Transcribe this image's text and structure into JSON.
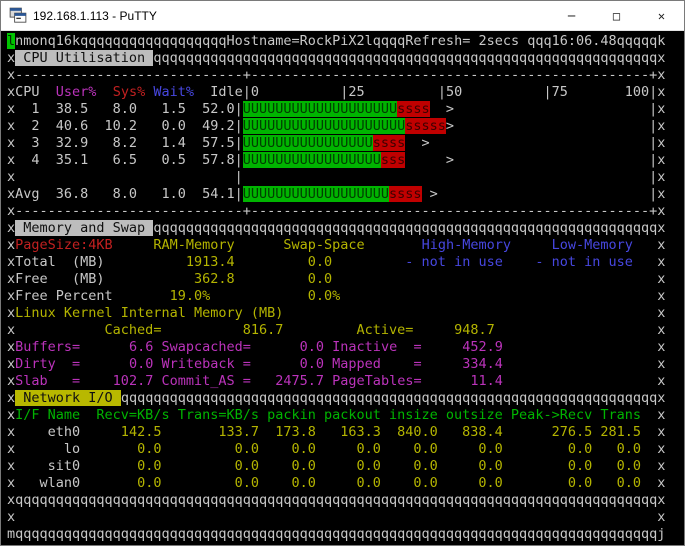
{
  "window": {
    "title": "192.168.1.113 - PuTTY",
    "minimize_icon": "─",
    "maximize_icon": "□",
    "close_icon": "✕"
  },
  "palette": {
    "terminal_bg": "#000000",
    "default_text": "#c8c8c8",
    "user_bar_green": "#00b400",
    "sys_bar_red": "#c00000",
    "value_yellow": "#b4b400",
    "kernel_magenta": "#bb33bb",
    "header_blue": "#4747e0",
    "section_inverse_grey": "#bdbdbd",
    "network_inverse_yellow": "#b8b800"
  },
  "terminal": {
    "lines": [
      {
        "right": "k",
        "seg": [
          {
            "t": "l",
            "s": "cur"
          },
          {
            "t": "nmonq16k"
          },
          {
            "t": "q",
            "r": 18
          },
          {
            "t": "Hostname=RockPiX2"
          },
          {
            "t": "lqqqq"
          },
          {
            "t": "Refresh= 2secs "
          },
          {
            "t": "qqq"
          },
          {
            "t": "16:06.48"
          },
          {
            "t": "q",
            "r": 5
          }
        ]
      },
      {
        "right": "x",
        "seg": [
          {
            "t": "x"
          },
          {
            "t": " CPU Utilisation ",
            "s": "inv"
          },
          {
            "t": "q",
            "r": 62
          }
        ]
      },
      {
        "right": "x",
        "seg": [
          {
            "t": "x"
          },
          {
            "t": "-",
            "r": 28
          },
          {
            "t": "+"
          },
          {
            "t": "-",
            "r": 49
          },
          {
            "t": "+"
          }
        ]
      },
      {
        "right": "x",
        "seg": [
          {
            "t": "x"
          },
          {
            "t": "CPU  "
          },
          {
            "t": "User%",
            "s": "mag"
          },
          {
            "t": "  "
          },
          {
            "t": "Sys%",
            "s": "red"
          },
          {
            "t": " "
          },
          {
            "t": "Wait%",
            "s": "blu"
          },
          {
            "t": "  "
          },
          {
            "t": "Idle"
          },
          {
            "t": "|0          |25         |50          |75       100|"
          }
        ]
      },
      {
        "right": "x",
        "seg": [
          {
            "t": "x"
          },
          {
            "t": "  1  38.5   8.0   1.5  52.0|"
          },
          {
            "t": "U",
            "s": "ub",
            "r": 19
          },
          {
            "t": "s",
            "s": "sb",
            "r": 4
          },
          {
            "t": "  >"
          },
          {
            "t": " ",
            "r": 24
          },
          {
            "t": "|"
          }
        ]
      },
      {
        "right": "x",
        "seg": [
          {
            "t": "x"
          },
          {
            "t": "  2  40.6  10.2   0.0  49.2|"
          },
          {
            "t": "U",
            "s": "ub",
            "r": 20
          },
          {
            "t": "s",
            "s": "sb",
            "r": 5
          },
          {
            "t": ">"
          },
          {
            "t": " ",
            "r": 24
          },
          {
            "t": "|"
          }
        ]
      },
      {
        "right": "x",
        "seg": [
          {
            "t": "x"
          },
          {
            "t": "  3  32.9   8.2   1.4  57.5|"
          },
          {
            "t": "U",
            "s": "ub",
            "r": 16
          },
          {
            "t": "s",
            "s": "sb",
            "r": 4
          },
          {
            "t": "  >"
          },
          {
            "t": " ",
            "r": 27
          },
          {
            "t": "|"
          }
        ]
      },
      {
        "right": "x",
        "seg": [
          {
            "t": "x"
          },
          {
            "t": "  4  35.1   6.5   0.5  57.8|"
          },
          {
            "t": "U",
            "s": "ub",
            "r": 17
          },
          {
            "t": "s",
            "s": "sb",
            "r": 3
          },
          {
            "t": "     >"
          },
          {
            "t": " ",
            "r": 24
          },
          {
            "t": "|"
          }
        ]
      },
      {
        "right": "x",
        "seg": [
          {
            "t": "x"
          },
          {
            "t": " ",
            "r": 27
          },
          {
            "t": "|"
          },
          {
            "t": " ",
            "r": 50
          },
          {
            "t": "|"
          }
        ]
      },
      {
        "right": "x",
        "seg": [
          {
            "t": "x"
          },
          {
            "t": "Avg  36.8   8.0   1.0  54.1|"
          },
          {
            "t": "U",
            "s": "ub",
            "r": 18
          },
          {
            "t": "s",
            "s": "sb",
            "r": 4
          },
          {
            "t": " >"
          },
          {
            "t": " ",
            "r": 26
          },
          {
            "t": "|"
          }
        ]
      },
      {
        "right": "x",
        "seg": [
          {
            "t": "x"
          },
          {
            "t": "-",
            "r": 28
          },
          {
            "t": "+"
          },
          {
            "t": "-",
            "r": 49
          },
          {
            "t": "+"
          }
        ]
      },
      {
        "right": "x",
        "seg": [
          {
            "t": "x"
          },
          {
            "t": " Memory and Swap ",
            "s": "inv"
          },
          {
            "t": "q",
            "r": 62
          }
        ]
      },
      {
        "right": "x",
        "seg": [
          {
            "t": "x"
          },
          {
            "t": "PageSize:4KB",
            "s": "red"
          },
          {
            "t": "     "
          },
          {
            "t": "RAM-Memory",
            "s": "yel"
          },
          {
            "t": "      "
          },
          {
            "t": "Swap-Space",
            "s": "yel"
          },
          {
            "t": "       "
          },
          {
            "t": "High-Memory",
            "s": "blu"
          },
          {
            "t": "     "
          },
          {
            "t": "Low-Memory",
            "s": "blu"
          },
          {
            "t": "   "
          }
        ]
      },
      {
        "right": "x",
        "seg": [
          {
            "t": "x"
          },
          {
            "t": "Total  (MB)"
          },
          {
            "t": "          1913.4",
            "s": "yel"
          },
          {
            "t": "         0.0",
            "s": "yel"
          },
          {
            "t": " ",
            "r": 9
          },
          {
            "t": "- not in use",
            "s": "blu"
          },
          {
            "t": "    "
          },
          {
            "t": "- not in use",
            "s": "blu"
          },
          {
            "t": "   "
          }
        ]
      },
      {
        "right": "x",
        "seg": [
          {
            "t": "x"
          },
          {
            "t": "Free   (MB)"
          },
          {
            "t": "           362.8",
            "s": "yel"
          },
          {
            "t": "         0.0",
            "s": "yel"
          },
          {
            "t": " ",
            "r": 40
          }
        ]
      },
      {
        "right": "x",
        "seg": [
          {
            "t": "x"
          },
          {
            "t": "Free Percent"
          },
          {
            "t": "       19.0%",
            "s": "yel"
          },
          {
            "t": "            0.0%",
            "s": "yel"
          },
          {
            "t": " ",
            "r": 39
          }
        ]
      },
      {
        "right": "x",
        "seg": [
          {
            "t": "x"
          },
          {
            "t": "Linux Kernel Internal Memory (MB)",
            "s": "yel"
          },
          {
            "t": " ",
            "r": 46
          }
        ]
      },
      {
        "right": "x",
        "seg": [
          {
            "t": "x"
          },
          {
            "t": " ",
            "r": 11
          },
          {
            "t": "Cached=",
            "s": "yel"
          },
          {
            "t": "          816.7",
            "s": "yel"
          },
          {
            "t": " ",
            "r": 9
          },
          {
            "t": "Active=",
            "s": "yel"
          },
          {
            "t": "     948.7",
            "s": "yel"
          },
          {
            "t": " ",
            "r": 20
          }
        ]
      },
      {
        "right": "x",
        "seg": [
          {
            "t": "x"
          },
          {
            "t": "Buffers=",
            "s": "mag"
          },
          {
            "t": "      6.6",
            "s": "mag"
          },
          {
            "t": " "
          },
          {
            "t": "Swapcached=",
            "s": "mag"
          },
          {
            "t": "      0.0",
            "s": "mag"
          },
          {
            "t": " "
          },
          {
            "t": "Inactive  =",
            "s": "mag"
          },
          {
            "t": "     452.9",
            "s": "mag"
          },
          {
            "t": " ",
            "r": 19
          }
        ]
      },
      {
        "right": "x",
        "seg": [
          {
            "t": "x"
          },
          {
            "t": "Dirty  =",
            "s": "mag"
          },
          {
            "t": "      0.0",
            "s": "mag"
          },
          {
            "t": " "
          },
          {
            "t": "Writeback =",
            "s": "mag"
          },
          {
            "t": "      0.0",
            "s": "mag"
          },
          {
            "t": " "
          },
          {
            "t": "Mapped    =",
            "s": "mag"
          },
          {
            "t": "     334.4",
            "s": "mag"
          },
          {
            "t": " ",
            "r": 19
          }
        ]
      },
      {
        "right": "x",
        "seg": [
          {
            "t": "x"
          },
          {
            "t": "Slab   =",
            "s": "mag"
          },
          {
            "t": "    102.7",
            "s": "mag"
          },
          {
            "t": " "
          },
          {
            "t": "Commit_AS =",
            "s": "mag"
          },
          {
            "t": "   2475.7",
            "s": "mag"
          },
          {
            "t": " "
          },
          {
            "t": "PageTables=",
            "s": "mag"
          },
          {
            "t": "      11.4",
            "s": "mag"
          },
          {
            "t": " ",
            "r": 19
          }
        ]
      },
      {
        "right": "x",
        "seg": [
          {
            "t": "x"
          },
          {
            "t": " Network I/O ",
            "s": "yinv"
          },
          {
            "t": "q",
            "r": 66
          }
        ]
      },
      {
        "right": "x",
        "seg": [
          {
            "t": "x"
          },
          {
            "t": "I/F Name  Recv=KB/s Trans=KB/s packin packout insize outsize Peak->Recv Trans  ",
            "s": "grn"
          }
        ]
      },
      {
        "right": "x",
        "seg": [
          {
            "t": "x"
          },
          {
            "t": "    eth0"
          },
          {
            "t": "     142.5       133.7  173.8   163.3  840.0   838.4      276.5 281.5",
            "s": "yel"
          },
          {
            "t": "  "
          }
        ]
      },
      {
        "right": "x",
        "seg": [
          {
            "t": "x"
          },
          {
            "t": "      lo"
          },
          {
            "t": "       0.0         0.0    0.0     0.0    0.0     0.0        0.0   0.0",
            "s": "yel"
          },
          {
            "t": "  "
          }
        ]
      },
      {
        "right": "x",
        "seg": [
          {
            "t": "x"
          },
          {
            "t": "    sit0"
          },
          {
            "t": "       0.0         0.0    0.0     0.0    0.0     0.0        0.0   0.0",
            "s": "yel"
          },
          {
            "t": "  "
          }
        ]
      },
      {
        "right": "x",
        "seg": [
          {
            "t": "x"
          },
          {
            "t": "   wlan0"
          },
          {
            "t": "       0.0         0.0    0.0     0.0    0.0     0.0        0.0   0.0",
            "s": "yel"
          },
          {
            "t": "  "
          }
        ]
      },
      {
        "right": "x",
        "seg": [
          {
            "t": "x"
          },
          {
            "t": "q",
            "r": 79
          }
        ]
      },
      {
        "right": "x",
        "seg": [
          {
            "t": "x"
          },
          {
            "t": " ",
            "r": 79
          }
        ]
      },
      {
        "right": "j",
        "seg": [
          {
            "t": "m"
          },
          {
            "t": "q",
            "r": 79
          }
        ]
      }
    ]
  }
}
